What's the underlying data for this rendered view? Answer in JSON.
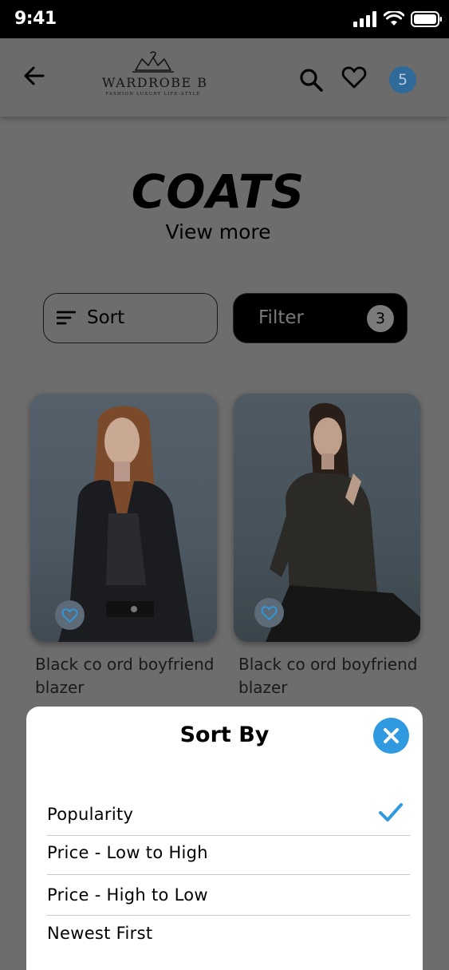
{
  "status_bar": {
    "time": "9:41"
  },
  "header": {
    "brand_name": "WARDROBE B",
    "brand_tagline": "FASHION LUXURY LIFE-STYLE",
    "cart_count": "5"
  },
  "page": {
    "title": "COATS",
    "view_more": "View more"
  },
  "toolbar": {
    "sort_label": "Sort",
    "filter_label": "Filter",
    "filter_count": "3"
  },
  "products": [
    {
      "name": "Black co ord boyfriend blazer"
    },
    {
      "name": "Black co ord boyfriend blazer"
    }
  ],
  "sort_sheet": {
    "title": "Sort By",
    "options": [
      {
        "label": "Popularity",
        "selected": true
      },
      {
        "label": "Price - Low to High",
        "selected": false
      },
      {
        "label": "Price - High to Low",
        "selected": false
      },
      {
        "label": "Newest First",
        "selected": false
      }
    ]
  },
  "colors": {
    "accent": "#2f9ae0",
    "overlay": "#6d6d6d",
    "badge": "#2f6a99"
  },
  "icons": [
    "back-arrow-icon",
    "search-icon",
    "heart-icon",
    "sort-lines-icon",
    "close-icon",
    "check-icon",
    "signal-icon",
    "wifi-icon",
    "battery-icon"
  ]
}
